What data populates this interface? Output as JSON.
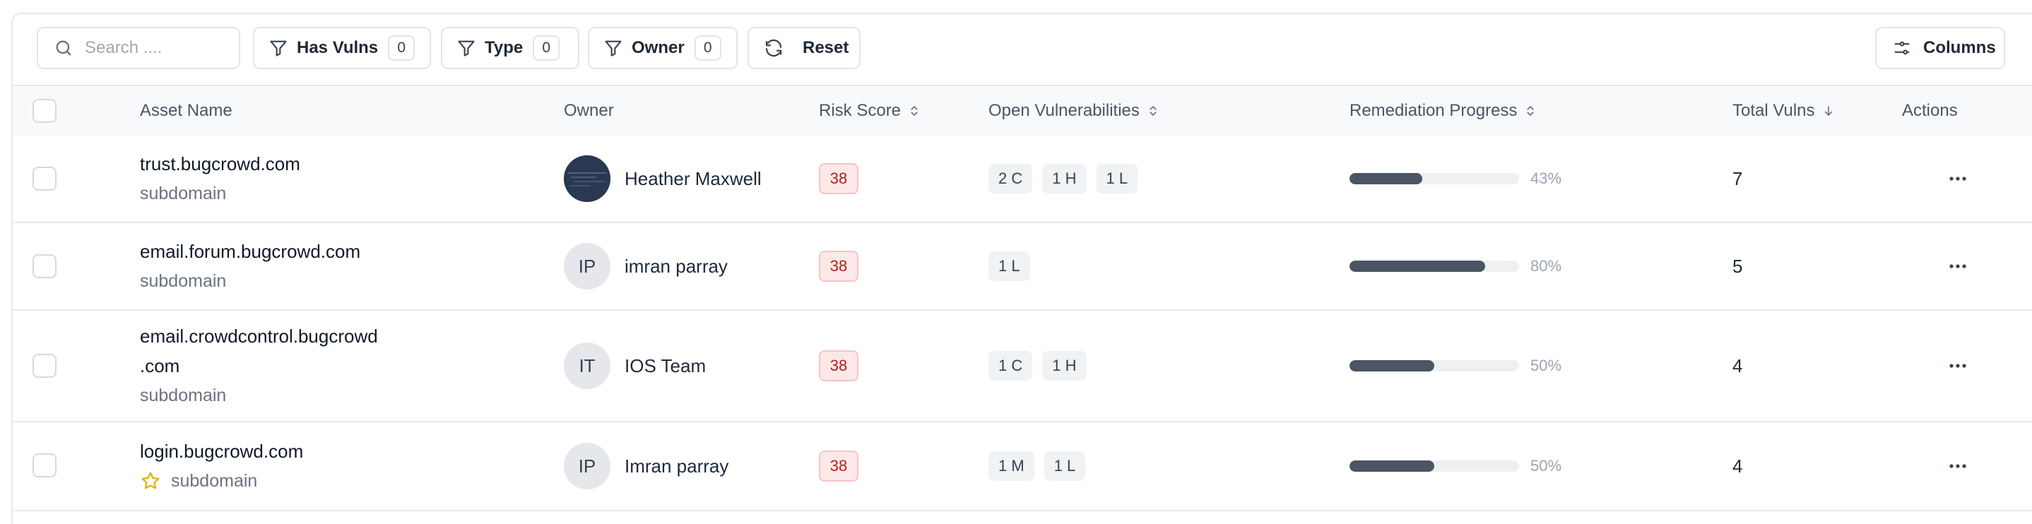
{
  "toolbar": {
    "search_placeholder": "Search ....",
    "filters": [
      {
        "label": "Has Vulns",
        "count": "0"
      },
      {
        "label": "Type",
        "count": "0"
      },
      {
        "label": "Owner",
        "count": "0"
      }
    ],
    "reset_label": "Reset",
    "columns_label": "Columns"
  },
  "table": {
    "headers": {
      "asset_name": "Asset Name",
      "owner": "Owner",
      "risk_score": "Risk Score",
      "open_vulns": "Open Vulnerabilities",
      "remediation": "Remediation Progress",
      "total_vulns": "Total Vulns",
      "actions": "Actions"
    },
    "rows": [
      {
        "asset_lines": [
          "trust.bugcrowd.com"
        ],
        "asset_type": "subdomain",
        "starred": false,
        "owner_name": "Heather Maxwell",
        "owner_initials": "",
        "owner_avatar": "photo",
        "risk": "38",
        "vulns": [
          "2 C",
          "1 H",
          "1 L"
        ],
        "progress": 0.43,
        "progress_label": "43%",
        "total": "7"
      },
      {
        "asset_lines": [
          "email.forum.bugcrowd.com"
        ],
        "asset_type": "subdomain",
        "starred": false,
        "owner_name": "imran parray",
        "owner_initials": "IP",
        "owner_avatar": "initials",
        "risk": "38",
        "vulns": [
          "1 L"
        ],
        "progress": 0.8,
        "progress_label": "80%",
        "total": "5"
      },
      {
        "asset_lines": [
          "email.crowdcontrol.bugcrowd",
          ".com"
        ],
        "asset_type": "subdomain",
        "starred": false,
        "owner_name": "IOS Team",
        "owner_initials": "IT",
        "owner_avatar": "initials",
        "risk": "38",
        "vulns": [
          "1 C",
          "1 H"
        ],
        "progress": 0.5,
        "progress_label": "50%",
        "total": "4"
      },
      {
        "asset_lines": [
          "login.bugcrowd.com"
        ],
        "asset_type": "subdomain",
        "starred": true,
        "owner_name": "Imran parray",
        "owner_initials": "IP",
        "owner_avatar": "initials",
        "risk": "38",
        "vulns": [
          "1 M",
          "1 L"
        ],
        "progress": 0.5,
        "progress_label": "50%",
        "total": "4"
      }
    ]
  },
  "colors": {
    "risk_bg": "#fde8e8",
    "risk_text": "#b91c1c",
    "progress_fill": "#4b5563",
    "star": "#e0b100"
  },
  "icons": {
    "search": "search-icon",
    "filter": "filter-icon",
    "reset": "refresh-icon",
    "columns": "sliders-icon",
    "sort": "sort-icon",
    "sort_desc": "arrow-down-icon",
    "actions": "more-horizontal-icon",
    "star": "star-icon"
  }
}
